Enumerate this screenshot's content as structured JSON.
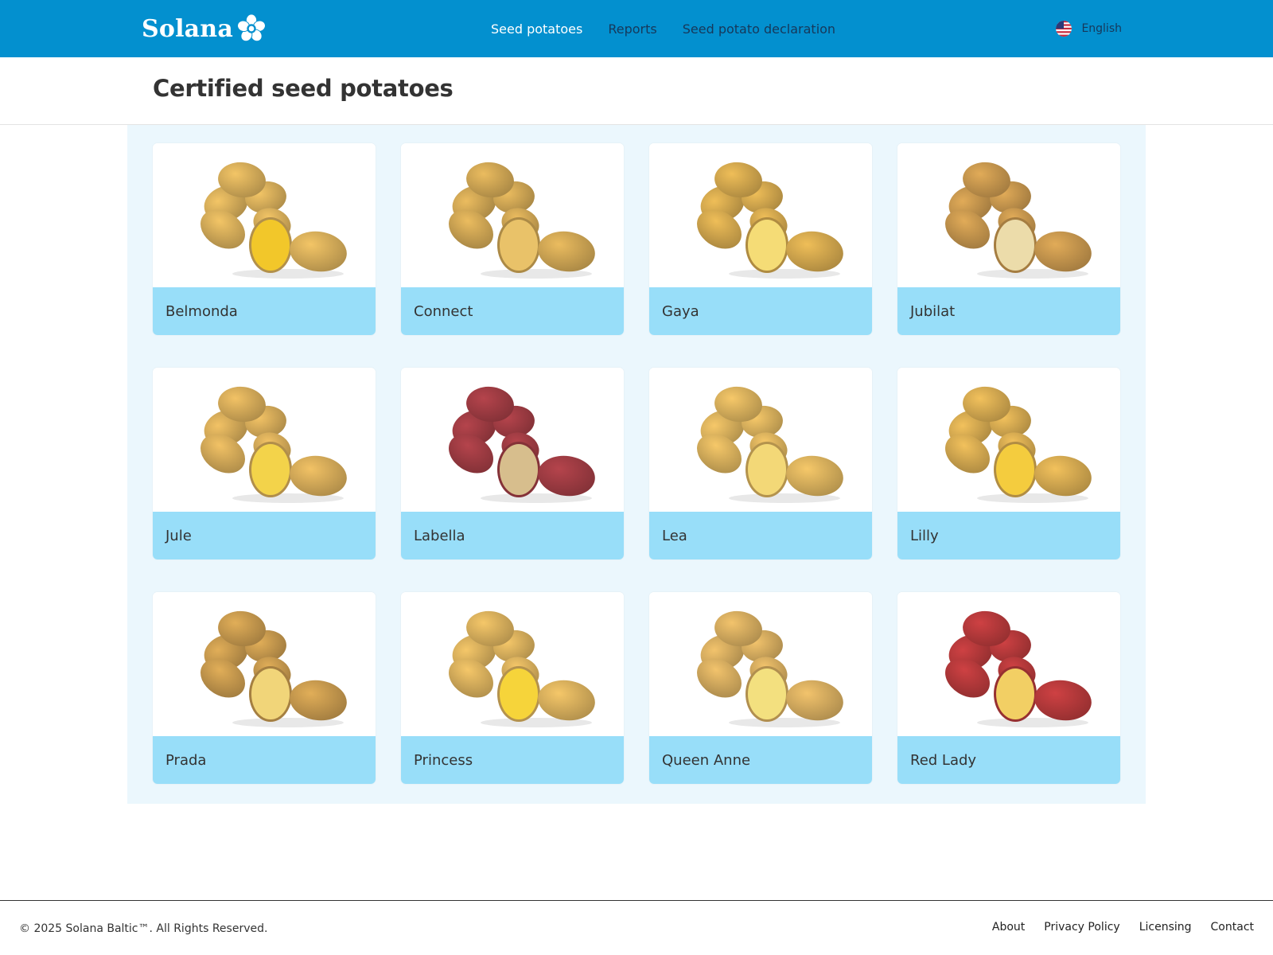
{
  "brand": {
    "name": "Solana",
    "logo_icon": "flower-icon"
  },
  "nav": {
    "items": [
      {
        "label": "Seed potatoes",
        "active": true
      },
      {
        "label": "Reports",
        "active": false
      },
      {
        "label": "Seed potato declaration",
        "active": false
      }
    ]
  },
  "language": {
    "label": "English",
    "icon": "us-flag-icon"
  },
  "page": {
    "title": "Certified seed potatoes"
  },
  "products": [
    {
      "name": "Belmonda",
      "skin": "#d9b05b",
      "flesh": "#f2c72a"
    },
    {
      "name": "Connect",
      "skin": "#d2a855",
      "flesh": "#e9c269"
    },
    {
      "name": "Gaya",
      "skin": "#d5aa4f",
      "flesh": "#f5dc76"
    },
    {
      "name": "Jubilat",
      "skin": "#c9994f",
      "flesh": "#ecdcaa"
    },
    {
      "name": "Jule",
      "skin": "#d8ad5a",
      "flesh": "#f3d34a"
    },
    {
      "name": "Labella",
      "skin": "#a23d44",
      "flesh": "#d7be8d"
    },
    {
      "name": "Lea",
      "skin": "#dcb35e",
      "flesh": "#f3d877"
    },
    {
      "name": "Lilly",
      "skin": "#d8ac52",
      "flesh": "#f4cc3e"
    },
    {
      "name": "Prada",
      "skin": "#c99b4f",
      "flesh": "#f1d579"
    },
    {
      "name": "Princess",
      "skin": "#dbb25e",
      "flesh": "#f6d43a"
    },
    {
      "name": "Queen Anne",
      "skin": "#d8ae60",
      "flesh": "#f3e07f"
    },
    {
      "name": "Red Lady",
      "skin": "#b83a3c",
      "flesh": "#f2cf64"
    }
  ],
  "footer": {
    "copyright": "© 2025 Solana Baltic™. All Rights Reserved.",
    "links": [
      "About",
      "Privacy Policy",
      "Licensing",
      "Contact"
    ]
  }
}
